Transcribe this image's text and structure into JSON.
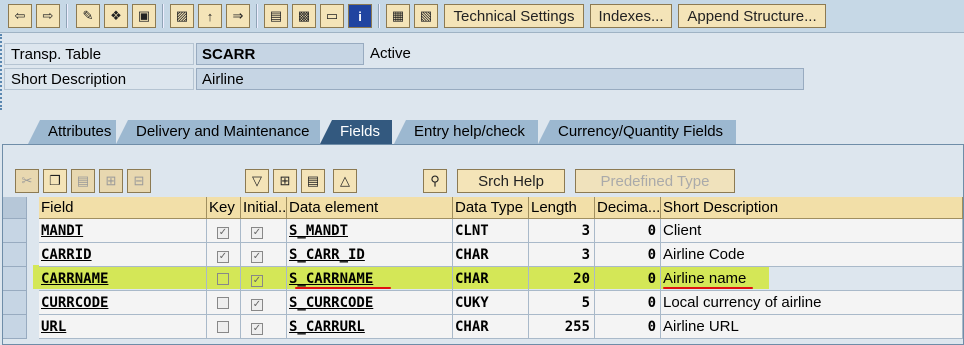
{
  "toolbar": {
    "icons": [
      "back-arrow-icon",
      "forward-arrow-icon",
      "display-change-icon",
      "other-object-icon",
      "activate-icon",
      "where-used-icon",
      "navigate-icon",
      "where-used-list-icon",
      "object-list-icon",
      "print-icon",
      "screen-icon",
      "info-icon",
      "hierarchy-icon",
      "layout-icon"
    ],
    "technical_settings_label": "Technical Settings",
    "indexes_label": "Indexes...",
    "append_structure_label": "Append Structure..."
  },
  "header": {
    "transp_table_label": "Transp. Table",
    "transp_table_value": "SCARR",
    "status": "Active",
    "short_desc_label": "Short Description",
    "short_desc_value": "Airline"
  },
  "tabs": [
    {
      "label": "Attributes",
      "active": false
    },
    {
      "label": "Delivery and Maintenance",
      "active": false
    },
    {
      "label": "Fields",
      "active": true
    },
    {
      "label": "Entry help/check",
      "active": false
    },
    {
      "label": "Currency/Quantity Fields",
      "active": false
    }
  ],
  "fields_toolbar": {
    "srch_help_label": "Srch Help",
    "predefined_type_label": "Predefined Type"
  },
  "table": {
    "columns": [
      "Field",
      "Key",
      "Initial...",
      "Data element",
      "Data Type",
      "Length",
      "Decima...",
      "Short Description"
    ],
    "rows": [
      {
        "field": "MANDT",
        "key": true,
        "initial": true,
        "data_element": "S_MANDT",
        "data_type": "CLNT",
        "length": "3",
        "decimals": "0",
        "short_desc": "Client"
      },
      {
        "field": "CARRID",
        "key": true,
        "initial": true,
        "data_element": "S_CARR_ID",
        "data_type": "CHAR",
        "length": "3",
        "decimals": "0",
        "short_desc": "Airline Code"
      },
      {
        "field": "CARRNAME",
        "key": false,
        "initial": true,
        "data_element": "S_CARRNAME",
        "data_type": "CHAR",
        "length": "20",
        "decimals": "0",
        "short_desc": "Airline name"
      },
      {
        "field": "CURRCODE",
        "key": false,
        "initial": true,
        "data_element": "S_CURRCODE",
        "data_type": "CUKY",
        "length": "5",
        "decimals": "0",
        "short_desc": "Local currency of airline"
      },
      {
        "field": "URL",
        "key": false,
        "initial": true,
        "data_element": "S_CARRURL",
        "data_type": "CHAR",
        "length": "255",
        "decimals": "0",
        "short_desc": "Airline URL"
      }
    ]
  },
  "colors": {
    "highlight": "#d2e63c",
    "annotation": "#e01010",
    "active_tab": "#33597f"
  }
}
